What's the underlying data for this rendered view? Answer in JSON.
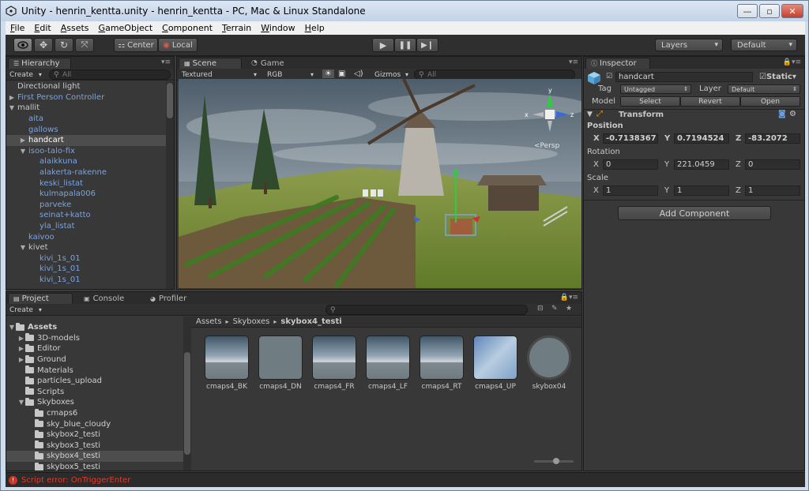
{
  "window": {
    "title": "Unity - henrin_kentta.unity - henrin_kentta - PC, Mac & Linux Standalone",
    "minimize": "—",
    "maximize": "▫",
    "close": "✕"
  },
  "menu": [
    "File",
    "Edit",
    "Assets",
    "GameObject",
    "Component",
    "Terrain",
    "Window",
    "Help"
  ],
  "toolbar": {
    "pivot": "Center",
    "space": "Local",
    "layers": "Layers",
    "layout": "Default"
  },
  "hierarchy": {
    "tab": "Hierarchy",
    "create": "Create",
    "search_placeholder": "All",
    "items": [
      {
        "label": "Directional light",
        "depth": 0,
        "arrow": "",
        "color": "#c8c8c8"
      },
      {
        "label": "First Person Controller",
        "depth": 0,
        "arrow": "▶",
        "color": "#7aa3e0"
      },
      {
        "label": "mallit",
        "depth": 0,
        "arrow": "▼",
        "color": "#c8c8c8"
      },
      {
        "label": "aita",
        "depth": 1,
        "arrow": "",
        "color": "#7aa3e0"
      },
      {
        "label": "gallows",
        "depth": 1,
        "arrow": "",
        "color": "#7aa3e0"
      },
      {
        "label": "handcart",
        "depth": 1,
        "arrow": "▶",
        "color": "#ffffff",
        "selected": true
      },
      {
        "label": "isoo-talo-fix",
        "depth": 1,
        "arrow": "▼",
        "color": "#7aa3e0"
      },
      {
        "label": "alaikkuna",
        "depth": 2,
        "arrow": "",
        "color": "#7aa3e0"
      },
      {
        "label": "alakerta-rakenne",
        "depth": 2,
        "arrow": "",
        "color": "#7aa3e0"
      },
      {
        "label": "keski_listat",
        "depth": 2,
        "arrow": "",
        "color": "#7aa3e0"
      },
      {
        "label": "kulmapala006",
        "depth": 2,
        "arrow": "",
        "color": "#7aa3e0"
      },
      {
        "label": "parveke",
        "depth": 2,
        "arrow": "",
        "color": "#7aa3e0"
      },
      {
        "label": "seinat+katto",
        "depth": 2,
        "arrow": "",
        "color": "#7aa3e0"
      },
      {
        "label": "yla_listat",
        "depth": 2,
        "arrow": "",
        "color": "#7aa3e0"
      },
      {
        "label": "kaivoo",
        "depth": 1,
        "arrow": "",
        "color": "#7aa3e0"
      },
      {
        "label": "kivet",
        "depth": 1,
        "arrow": "▼",
        "color": "#c8c8c8"
      },
      {
        "label": "kivi_1s_01",
        "depth": 2,
        "arrow": "",
        "color": "#7aa3e0"
      },
      {
        "label": "kivi_1s_01",
        "depth": 2,
        "arrow": "",
        "color": "#7aa3e0"
      },
      {
        "label": "kivi_1s_01",
        "depth": 2,
        "arrow": "",
        "color": "#7aa3e0"
      }
    ]
  },
  "scene": {
    "tab_scene": "Scene",
    "tab_game": "Game",
    "render_mode": "Textured",
    "color_mode": "RGB",
    "gizmos": "Gizmos",
    "search_placeholder": "All",
    "persp": "Persp",
    "axis_x": "x",
    "axis_y": "y",
    "axis_z": "z"
  },
  "inspector": {
    "tab": "Inspector",
    "object_name": "handcart",
    "static_label": "Static",
    "tag_label": "Tag",
    "tag_value": "Untagged",
    "layer_label": "Layer",
    "layer_value": "Default",
    "model_label": "Model",
    "select": "Select",
    "revert": "Revert",
    "open": "Open",
    "transform_title": "Transform",
    "position_label": "Position",
    "rotation_label": "Rotation",
    "scale_label": "Scale",
    "x": "X",
    "y": "Y",
    "z": "Z",
    "position": {
      "x": "-0.7138367",
      "y": "0.7194524",
      "z": "-83.2072"
    },
    "rotation": {
      "x": "0",
      "y": "221.0459",
      "z": "0"
    },
    "scale": {
      "x": "1",
      "y": "1",
      "z": "1"
    },
    "add_component": "Add Component"
  },
  "project": {
    "tab_project": "Project",
    "tab_console": "Console",
    "tab_profiler": "Profiler",
    "create": "Create",
    "breadcrumb": [
      "Assets",
      "Skyboxes",
      "skybox4_testi"
    ],
    "tree": [
      {
        "label": "Assets",
        "depth": 0,
        "arrow": "▼",
        "bold": true
      },
      {
        "label": "3D-models",
        "depth": 1,
        "arrow": "▶"
      },
      {
        "label": "Editor",
        "depth": 1,
        "arrow": "▶"
      },
      {
        "label": "Ground",
        "depth": 1,
        "arrow": "▶"
      },
      {
        "label": "Materials",
        "depth": 1,
        "arrow": ""
      },
      {
        "label": "particles_upload",
        "depth": 1,
        "arrow": ""
      },
      {
        "label": "Scripts",
        "depth": 1,
        "arrow": ""
      },
      {
        "label": "Skyboxes",
        "depth": 1,
        "arrow": "▼"
      },
      {
        "label": "cmaps6",
        "depth": 2,
        "arrow": ""
      },
      {
        "label": "sky_blue_cloudy",
        "depth": 2,
        "arrow": ""
      },
      {
        "label": "skybox2_testi",
        "depth": 2,
        "arrow": ""
      },
      {
        "label": "skybox3_testi",
        "depth": 2,
        "arrow": ""
      },
      {
        "label": "skybox4_testi",
        "depth": 2,
        "arrow": "",
        "selected": true
      },
      {
        "label": "skybox5_testi",
        "depth": 2,
        "arrow": ""
      }
    ],
    "assets": [
      {
        "label": "cmaps4_BK",
        "kind": "cloudy"
      },
      {
        "label": "cmaps4_DN",
        "kind": "plain"
      },
      {
        "label": "cmaps4_FR",
        "kind": "cloudy"
      },
      {
        "label": "cmaps4_LF",
        "kind": "cloudy"
      },
      {
        "label": "cmaps4_RT",
        "kind": "cloudy"
      },
      {
        "label": "cmaps4_UP",
        "kind": "sky"
      },
      {
        "label": "skybox04",
        "kind": "sphere"
      }
    ]
  },
  "status": {
    "error": "Script error: OnTriggerEnter"
  }
}
